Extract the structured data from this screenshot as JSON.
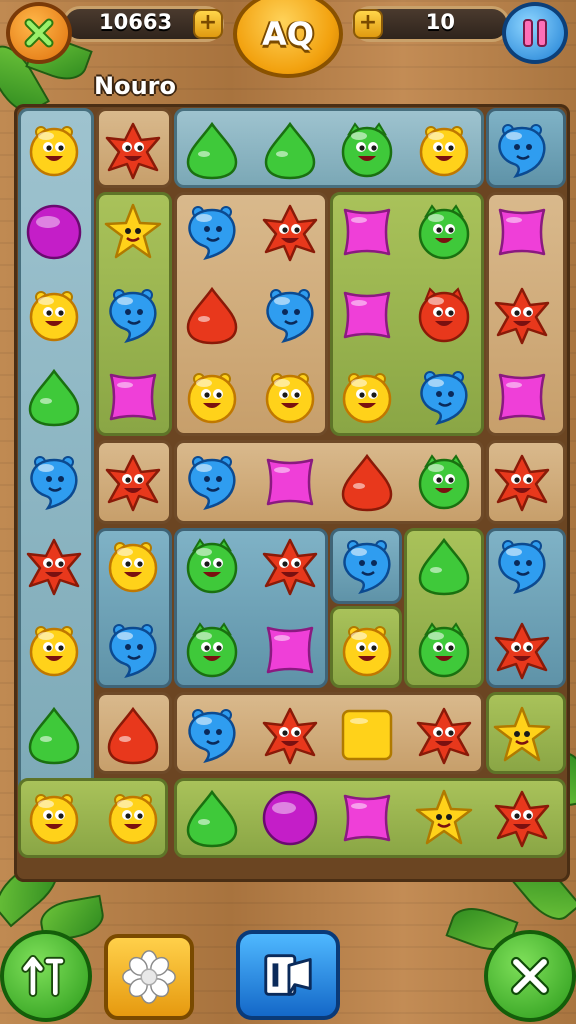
{
  "hud": {
    "score": "10663",
    "moves": "10",
    "level_label": "AQ",
    "player_name": "Nouro",
    "plus_symbol": "+"
  },
  "icons": {
    "close_top": "close-icon",
    "pause": "pause-icon",
    "shuffle": "shuffle-arrows-icon",
    "flower": "flower-icon",
    "hint": "hint-card-icon",
    "exit": "close-icon"
  },
  "colors": {
    "red": "#e8381c",
    "blue": "#2f9df0",
    "green": "#3fc93a",
    "yellow": "#ffd21a",
    "pink": "#ef3fd8",
    "purple": "#c41ec8"
  },
  "board": {
    "columns": 7,
    "rows": 9,
    "grid": [
      [
        "yellow-face",
        "red-star",
        "green-drop",
        "green-drop",
        "green-face",
        "yellow-face",
        "blue-ghost"
      ],
      [
        "purple-orb",
        "yellow-star",
        "blue-ghost",
        "red-star",
        "pink-square",
        "green-face",
        "pink-square"
      ],
      [
        "yellow-face",
        "blue-ghost",
        "red-drop",
        "blue-ghost",
        "pink-square",
        "red-face",
        "red-star"
      ],
      [
        "green-drop",
        "pink-square",
        "yellow-face",
        "yellow-face",
        "yellow-face",
        "blue-ghost",
        "pink-square"
      ],
      [
        "blue-ghost",
        "red-star",
        "blue-ghost",
        "pink-square",
        "red-drop",
        "green-face",
        "red-star"
      ],
      [
        "red-star",
        "yellow-face",
        "green-face",
        "red-star",
        "blue-ghost",
        "green-drop",
        "blue-ghost"
      ],
      [
        "yellow-face",
        "blue-ghost",
        "green-face",
        "pink-square",
        "yellow-face",
        "green-face",
        "red-star"
      ],
      [
        "green-drop",
        "red-drop",
        "blue-ghost",
        "red-star",
        "yellow-square",
        "red-star",
        "yellow-star"
      ],
      [
        "yellow-face",
        "yellow-face",
        "green-drop",
        "purple-orb",
        "pink-square",
        "yellow-star",
        "red-star"
      ]
    ]
  }
}
